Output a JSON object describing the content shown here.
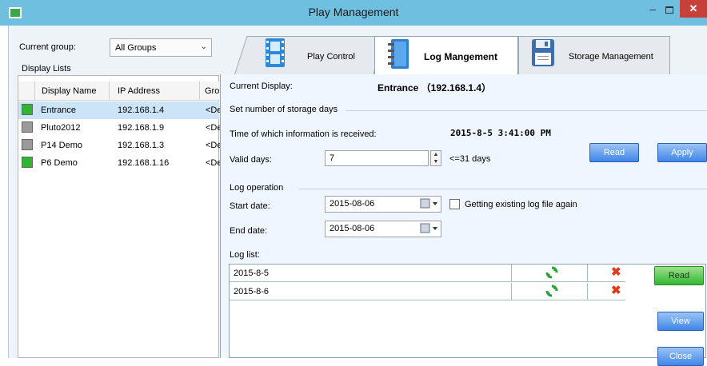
{
  "window": {
    "title": "Play Management"
  },
  "left": {
    "group_label": "Current group:",
    "group_value": "All Groups",
    "display_lists_label": "Display Lists",
    "columns": [
      "Display Name",
      "IP Address",
      "Gro"
    ],
    "rows": [
      {
        "name": "Entrance",
        "ip": "192.168.1.4",
        "group": "<De",
        "status": "online",
        "selected": true
      },
      {
        "name": "Pluto2012",
        "ip": "192.168.1.9",
        "group": "<De",
        "status": "offline",
        "selected": false
      },
      {
        "name": "P14 Demo",
        "ip": "192.168.1.3",
        "group": "<De",
        "status": "offline",
        "selected": false
      },
      {
        "name": "P6 Demo",
        "ip": "192.168.1.16",
        "group": "<De",
        "status": "online",
        "selected": false
      }
    ]
  },
  "tabs": [
    {
      "label": "Play Control",
      "active": false
    },
    {
      "label": "Log Mangement",
      "active": true
    },
    {
      "label": "Storage Management",
      "active": false
    }
  ],
  "content": {
    "current_display_label": "Current Display:",
    "current_display_value": "Entrance （192.168.1.4）",
    "storage_section": "Set number of storage days",
    "time_label": "Time of which information is received:",
    "time_value": "2015-8-5  3:41:00 PM",
    "valid_days_label": "Valid days:",
    "valid_days_value": "7",
    "valid_days_hint": "<=31 days",
    "read_label": "Read",
    "apply_label": "Apply",
    "log_operation_label": "Log operation",
    "start_date_label": "Start date:",
    "start_date_value": "2015-08-06",
    "end_date_label": "End date:",
    "end_date_value": "2015-08-06",
    "checkbox_label": "Getting existing log file again",
    "log_list_label": "Log list:",
    "log_rows": [
      "2015-8-5",
      "2015-8-6"
    ],
    "side_read_label": "Read",
    "view_label": "View",
    "close_label": "Close"
  },
  "colors": {
    "titlebar": "#6fbfe0",
    "online": "#2fb52f",
    "offline": "#9a9a9a",
    "delete": "#e03a1c",
    "refresh": "#27a33a"
  }
}
